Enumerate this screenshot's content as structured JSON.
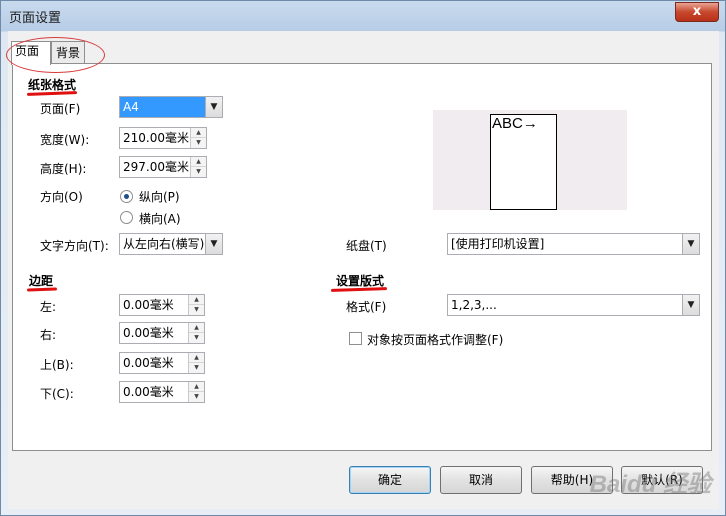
{
  "window": {
    "title": "页面设置",
    "close_label": "x"
  },
  "tabs": [
    {
      "label": "页面"
    },
    {
      "label": "背景"
    }
  ],
  "paper": {
    "section_title": "纸张格式",
    "page_label": "页面(F)",
    "page_value": "A4",
    "width_label": "宽度(W):",
    "width_value": "210.00毫米",
    "height_label": "高度(H):",
    "height_value": "297.00毫米",
    "orientation_label": "方向(O)",
    "portrait_label": "纵向(P)",
    "landscape_label": "横向(A)",
    "text_direction_label": "文字方向(T):",
    "text_direction_value": "从左向右(横写)",
    "tray_label": "纸盘(T)",
    "tray_value": "[使用打印机设置]",
    "preview_text": "ABC→"
  },
  "margins": {
    "section_title": "边距",
    "left_label": "左:",
    "left_value": "0.00毫米",
    "right_label": "右:",
    "right_value": "0.00毫米",
    "top_label": "上(B):",
    "top_value": "0.00毫米",
    "bottom_label": "下(C):",
    "bottom_value": "0.00毫米"
  },
  "layout": {
    "section_title": "设置版式",
    "format_label": "格式(F)",
    "format_value": "1,2,3,...",
    "adjust_label": "对象按页面格式作调整(F)"
  },
  "buttons": {
    "ok": "确定",
    "cancel": "取消",
    "help": "帮助(H)",
    "default": "默认(R)"
  },
  "watermark": "Baidu 经验",
  "colors": {
    "annotation_red": "#e01010",
    "selection_blue": "#3399ff"
  }
}
